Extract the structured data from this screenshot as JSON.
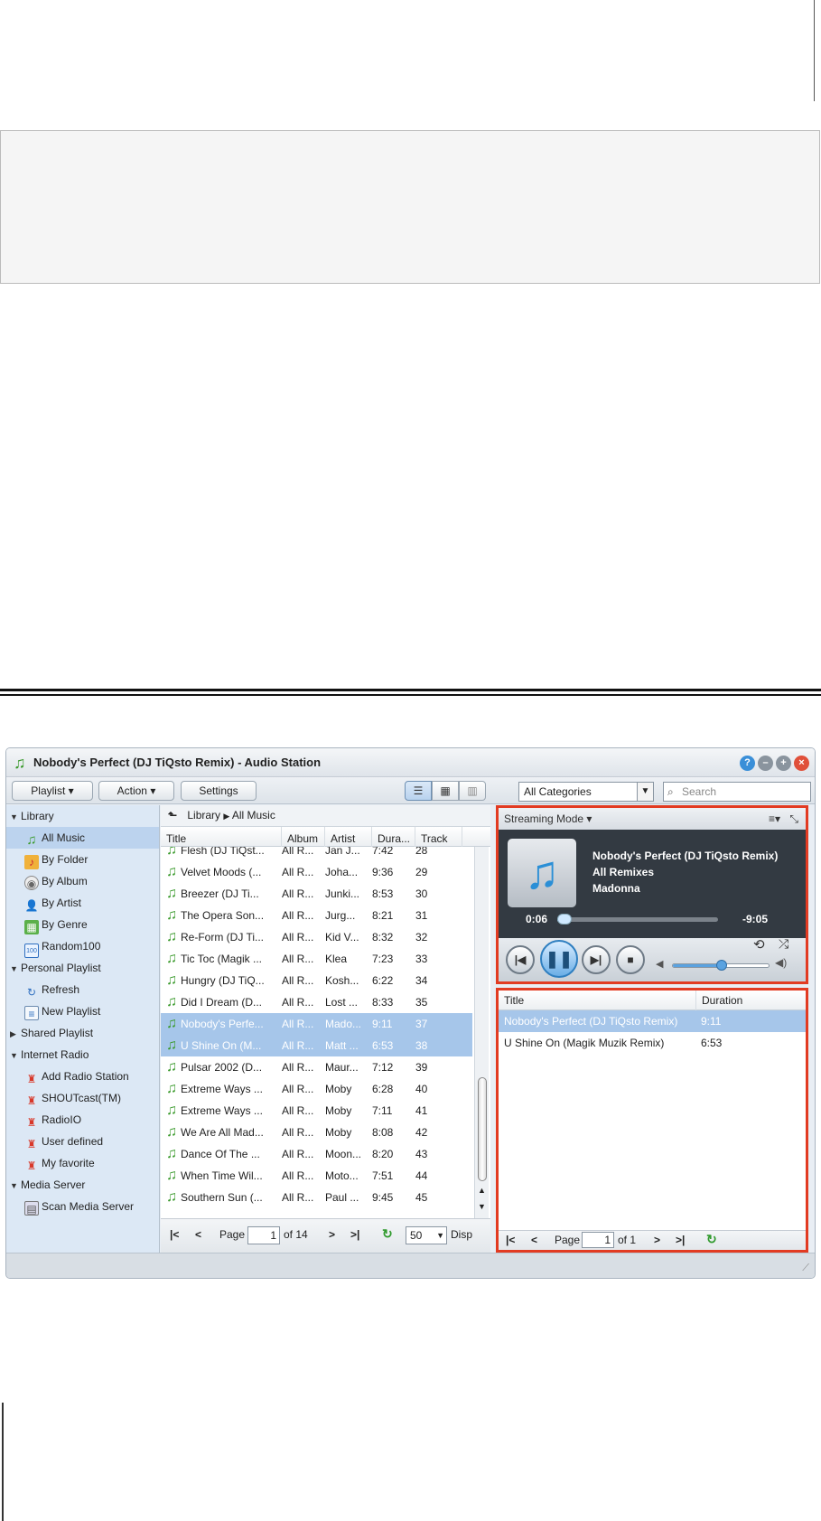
{
  "window": {
    "title": "Nobody's Perfect (DJ TiQsto Remix) - Audio Station",
    "buttons": [
      "?",
      "–",
      "+",
      "×"
    ]
  },
  "toolbar": {
    "playlist_label": "Playlist",
    "action_label": "Action",
    "settings_label": "Settings",
    "category_value": "All Categories",
    "search_placeholder": "Search"
  },
  "sidebar": {
    "groups": [
      {
        "label": "Library",
        "expanded": true
      },
      {
        "label": "Personal Playlist",
        "expanded": true
      },
      {
        "label": "Shared Playlist",
        "expanded": false
      },
      {
        "label": "Internet Radio",
        "expanded": true
      },
      {
        "label": "Media Server",
        "expanded": true
      }
    ],
    "items": [
      {
        "label": "All Music",
        "icon": "music-note-icon"
      },
      {
        "label": "By Folder",
        "icon": "folder-icon"
      },
      {
        "label": "By Album",
        "icon": "cd-icon"
      },
      {
        "label": "By Artist",
        "icon": "person-icon"
      },
      {
        "label": "By Genre",
        "icon": "genre-icon"
      },
      {
        "label": "Random100",
        "icon": "random-icon"
      },
      {
        "label": "Refresh",
        "icon": "refresh-icon"
      },
      {
        "label": "New Playlist",
        "icon": "new-playlist-icon"
      },
      {
        "label": "Add Radio Station",
        "icon": "add-radio-icon"
      },
      {
        "label": "SHOUTcast(TM)",
        "icon": "radio-tower-icon"
      },
      {
        "label": "RadioIO",
        "icon": "radio-tower-icon"
      },
      {
        "label": "User defined",
        "icon": "radio-tower-icon"
      },
      {
        "label": "My favorite",
        "icon": "radio-tower-icon"
      },
      {
        "label": "Scan Media Server",
        "icon": "server-icon"
      }
    ]
  },
  "breadcrumb": {
    "root": "Library",
    "current": "All Music"
  },
  "songlist": {
    "columns": [
      "Title",
      "Album",
      "Artist",
      "Dura...",
      "Track"
    ],
    "rows": [
      [
        "Flesh (DJ TiQst...",
        "All R...",
        "Jan J...",
        "7:42",
        "28"
      ],
      [
        "Velvet Moods (...",
        "All R...",
        "Joha...",
        "9:36",
        "29"
      ],
      [
        "Breezer (DJ Ti...",
        "All R...",
        "Junki...",
        "8:53",
        "30"
      ],
      [
        "The Opera Son...",
        "All R...",
        "Jurg...",
        "8:21",
        "31"
      ],
      [
        "Re-Form (DJ Ti...",
        "All R...",
        "Kid V...",
        "8:32",
        "32"
      ],
      [
        "Tic Toc (Magik ...",
        "All R...",
        "Klea",
        "7:23",
        "33"
      ],
      [
        "Hungry (DJ TiQ...",
        "All R...",
        "Kosh...",
        "6:22",
        "34"
      ],
      [
        "Did I Dream (D...",
        "All R...",
        "Lost ...",
        "8:33",
        "35"
      ],
      [
        "Nobody's Perfe...",
        "All R...",
        "Mado...",
        "9:11",
        "37"
      ],
      [
        "U Shine On (M...",
        "All R...",
        "Matt ...",
        "6:53",
        "38"
      ],
      [
        "Pulsar 2002 (D...",
        "All R...",
        "Maur...",
        "7:12",
        "39"
      ],
      [
        "Extreme Ways ...",
        "All R...",
        "Moby",
        "6:28",
        "40"
      ],
      [
        "Extreme Ways ...",
        "All R...",
        "Moby",
        "7:11",
        "41"
      ],
      [
        "We Are All Mad...",
        "All R...",
        "Moby",
        "8:08",
        "42"
      ],
      [
        "Dance Of The ...",
        "All R...",
        "Moon...",
        "8:20",
        "43"
      ],
      [
        "When Time Wil...",
        "All R...",
        "Moto...",
        "7:51",
        "44"
      ],
      [
        "Southern Sun (...",
        "All R...",
        "Paul ...",
        "9:45",
        "45"
      ]
    ],
    "selected_rows": [
      8,
      9
    ],
    "pager": {
      "page_label": "Page",
      "page": "1",
      "of_label": "of 14",
      "page_size": "50",
      "display_label": "Disp"
    }
  },
  "player": {
    "mode": "Streaming Mode",
    "title": "Nobody's Perfect (DJ TiQsto Remix)",
    "album": "All Remixes",
    "artist": "Madonna",
    "elapsed": "0:06",
    "remaining": "-9:05",
    "progress": 0.011,
    "volume": 0.5
  },
  "playlist": {
    "columns": [
      "Title",
      "Duration"
    ],
    "rows": [
      [
        "Nobody's Perfect (DJ TiQsto Remix)",
        "9:11"
      ],
      [
        "U Shine On (Magik Muzik Remix)",
        "6:53"
      ]
    ],
    "pager": {
      "page_label": "Page",
      "page": "1",
      "of_label": "of 1"
    }
  },
  "colors": {
    "accent": "#e23b22",
    "selection": "#a6c6ea",
    "sidebar": "#dce8f5"
  }
}
